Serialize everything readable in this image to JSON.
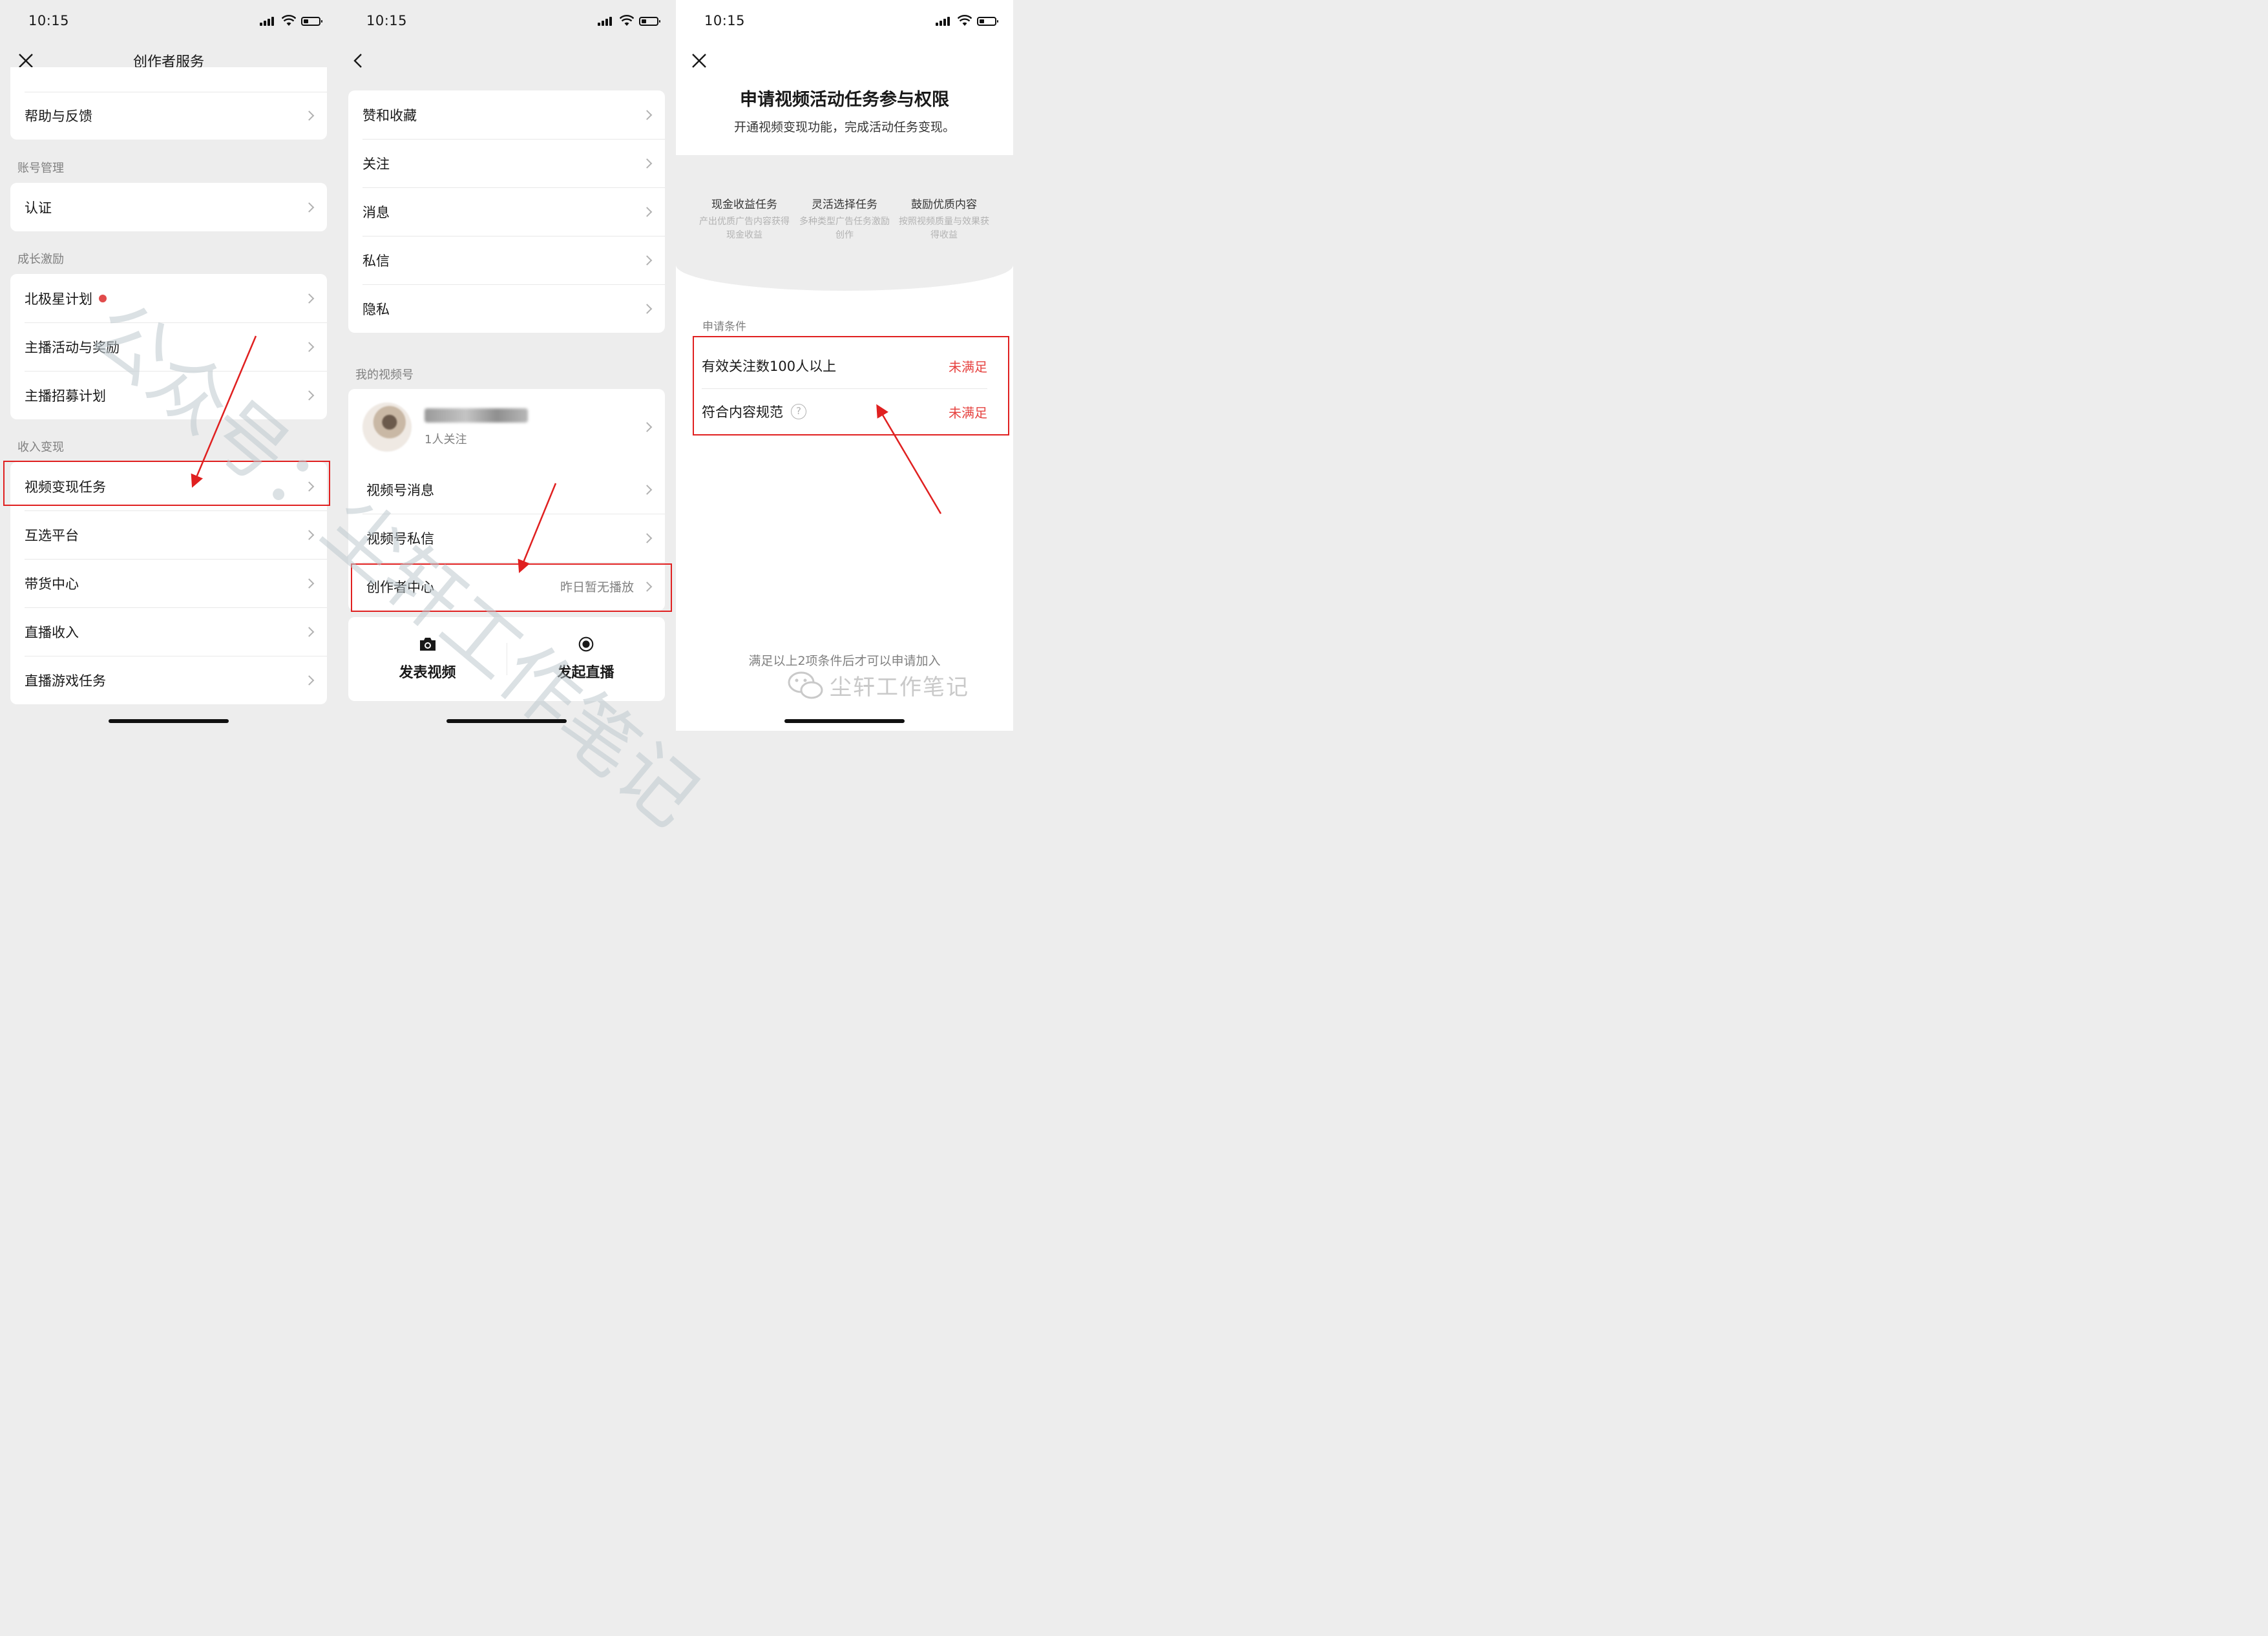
{
  "status_time": "10:15",
  "panel1": {
    "title": "创作者服务",
    "top_item": "帮助与反馈",
    "sections": [
      {
        "label": "账号管理",
        "items": [
          "认证"
        ]
      },
      {
        "label": "成长激励",
        "items": [
          "北极星计划",
          "主播活动与奖励",
          "主播招募计划"
        ]
      },
      {
        "label": "收入变现",
        "items": [
          "视频变现任务",
          "互选平台",
          "带货中心",
          "直播收入",
          "直播游戏任务"
        ]
      }
    ]
  },
  "panel2": {
    "items_top": [
      "赞和收藏",
      "关注",
      "消息",
      "私信",
      "隐私"
    ],
    "section_label": "我的视频号",
    "profile_follow": "1人关注",
    "items_bottom": [
      "视频号消息",
      "视频号私信",
      "创作者中心"
    ],
    "creator_center_note": "昨日暂无播放",
    "actions": [
      "发表视频",
      "发起直播"
    ]
  },
  "panel3": {
    "title": "申请视频活动任务参与权限",
    "subtitle": "开通视频变现功能，完成活动任务变现。",
    "features": [
      {
        "title": "现金收益任务",
        "desc": "产出优质广告内容获得现金收益"
      },
      {
        "title": "灵活选择任务",
        "desc": "多种类型广告任务激励创作"
      },
      {
        "title": "鼓励优质内容",
        "desc": "按照视频质量与效果获得收益"
      }
    ],
    "conditions_label": "申请条件",
    "conditions": [
      {
        "label": "有效关注数100人以上",
        "status": "未满足"
      },
      {
        "label": "符合内容规范",
        "status": "未满足"
      }
    ],
    "footer": "满足以上2项条件后才可以申请加入"
  },
  "watermark": {
    "text": "公众号：尘轩工作笔记",
    "brand": "尘轩工作笔记"
  },
  "colors": {
    "accent_red": "#e02020",
    "status_red": "#e64340",
    "bg": "#ededed"
  }
}
